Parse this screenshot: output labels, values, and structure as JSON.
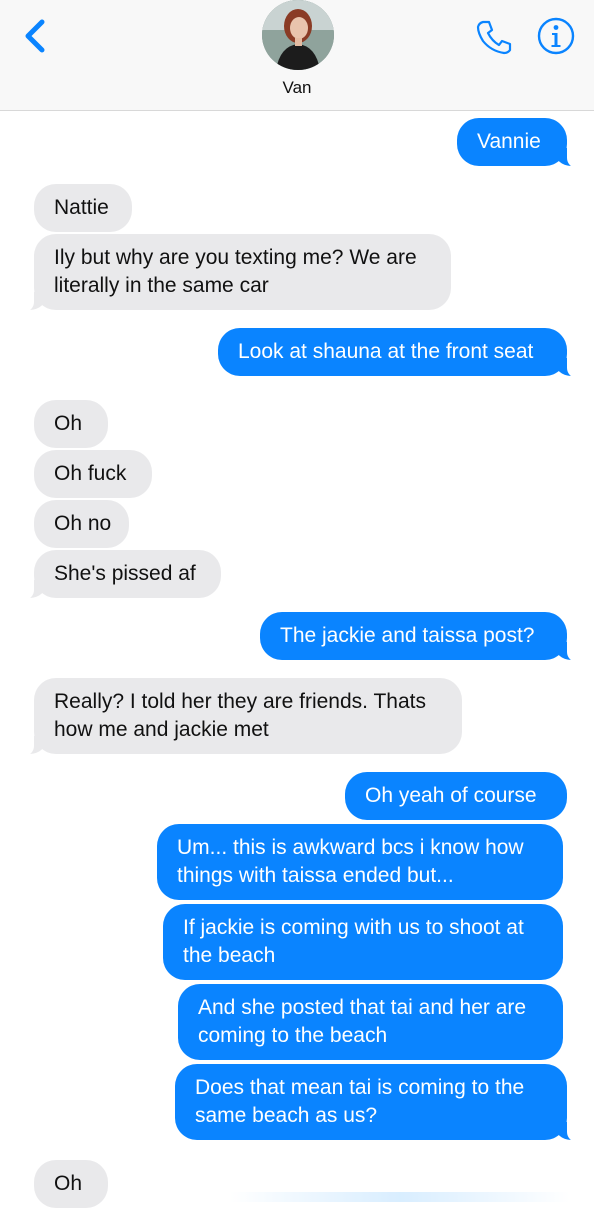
{
  "header": {
    "contact_name": "Van",
    "colors": {
      "accent": "#0a84ff",
      "header_bg": "#f8f8f8"
    },
    "icons": [
      "chevron-left-icon",
      "phone-icon",
      "info-icon"
    ]
  },
  "colors": {
    "outgoing": "#0a84ff",
    "incoming": "#e9e9eb"
  },
  "messages": [
    {
      "dir": "out",
      "lines": [
        "Vannie"
      ]
    },
    {
      "dir": "in",
      "lines": [
        "Nattie"
      ]
    },
    {
      "dir": "in",
      "lines": [
        "Ily but why are you texting me? We are",
        "literally in the same car"
      ]
    },
    {
      "dir": "out",
      "lines": [
        "Look at shauna at the front seat"
      ]
    },
    {
      "dir": "in",
      "lines": [
        "Oh"
      ]
    },
    {
      "dir": "in",
      "lines": [
        "Oh fuck"
      ]
    },
    {
      "dir": "in",
      "lines": [
        "Oh no"
      ]
    },
    {
      "dir": "in",
      "lines": [
        "She's pissed af"
      ]
    },
    {
      "dir": "out",
      "lines": [
        "The jackie and taissa post?"
      ]
    },
    {
      "dir": "in",
      "lines": [
        "Really? I told her they are friends. Thats",
        "how me and jackie met"
      ]
    },
    {
      "dir": "out",
      "lines": [
        "Oh yeah of course"
      ]
    },
    {
      "dir": "out",
      "lines": [
        "Um... this is awkward bcs i know how",
        "things with taissa ended but..."
      ]
    },
    {
      "dir": "out",
      "lines": [
        "If jackie is coming with us to shoot at",
        "the beach"
      ]
    },
    {
      "dir": "out",
      "lines": [
        "And she posted that tai and her are",
        "coming to the beach"
      ]
    },
    {
      "dir": "out",
      "lines": [
        "Does that mean tai is coming to the",
        "same beach as us?"
      ]
    },
    {
      "dir": "in",
      "lines": [
        "Oh"
      ]
    }
  ]
}
